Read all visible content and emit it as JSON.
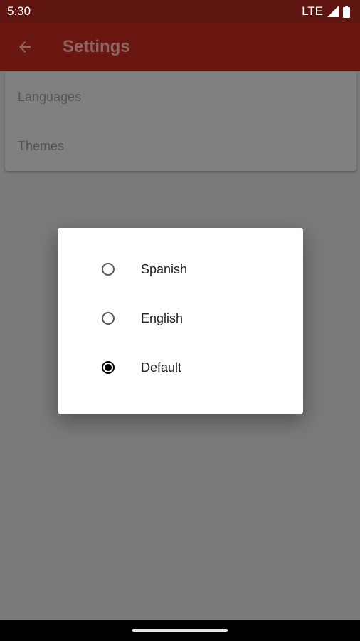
{
  "status_bar": {
    "time": "5:30",
    "network": "LTE",
    "icons": [
      "signal-icon",
      "battery-icon"
    ]
  },
  "app_bar": {
    "title": "Settings",
    "back_icon": "arrow-back-icon"
  },
  "settings": {
    "items": [
      {
        "label": "Languages"
      },
      {
        "label": "Themes"
      }
    ]
  },
  "language_dialog": {
    "options": [
      {
        "label": "Spanish",
        "selected": false
      },
      {
        "label": "English",
        "selected": false
      },
      {
        "label": "Default",
        "selected": true
      }
    ]
  },
  "colors": {
    "status_bar": "#5f1510",
    "app_bar": "#6a1711",
    "scrim_background": "#7a7a7a",
    "dialog": "#ffffff"
  }
}
